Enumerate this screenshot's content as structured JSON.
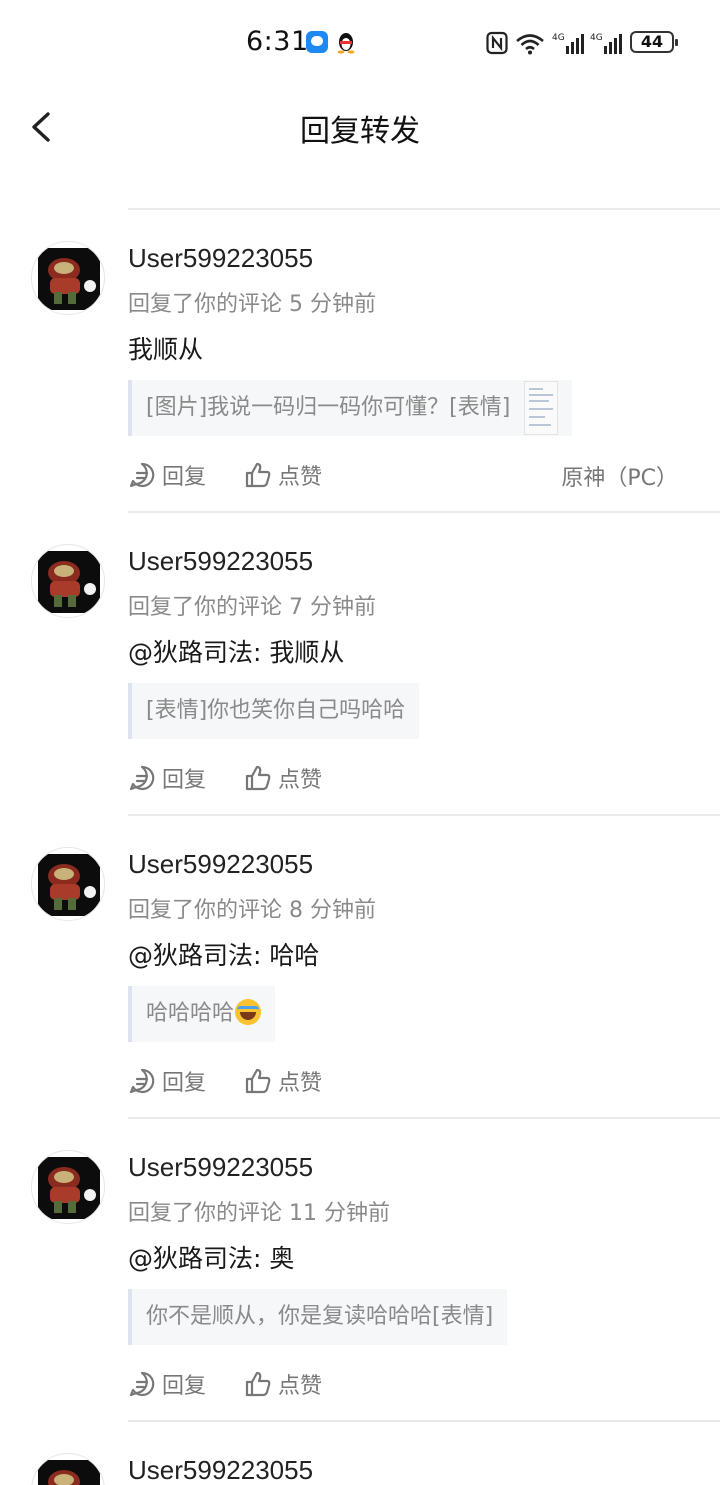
{
  "status_bar": {
    "time": "6:31",
    "battery": "44"
  },
  "header": {
    "title": "回复转发"
  },
  "items": [
    {
      "username": "User599223055",
      "meta": "回复了你的评论 5 分钟前",
      "content": "我顺从",
      "quote": "[图片]我说一码归一码你可懂？[表情]",
      "has_thumb": true,
      "reply_label": "回复",
      "like_label": "点赞",
      "platform": "原神（PC）"
    },
    {
      "username": "User599223055",
      "meta": "回复了你的评论 7 分钟前",
      "content": "@狄路司法: 我顺从",
      "quote": "[表情]你也笑你自己吗哈哈",
      "reply_label": "回复",
      "like_label": "点赞"
    },
    {
      "username": "User599223055",
      "meta": "回复了你的评论 8 分钟前",
      "content": "@狄路司法: 哈哈",
      "quote": "哈哈哈哈",
      "quote_emoji": "laughing-crying-emoji",
      "reply_label": "回复",
      "like_label": "点赞"
    },
    {
      "username": "User599223055",
      "meta": "回复了你的评论 11 分钟前",
      "content": "@狄路司法: 奥",
      "quote": "你不是顺从，你是复读哈哈哈[表情]",
      "reply_label": "回复",
      "like_label": "点赞"
    },
    {
      "username": "User599223055"
    }
  ],
  "icons": {
    "back": "chevron-left-icon",
    "reply": "comment-bubble-icon",
    "like": "thumbs-up-icon"
  },
  "colors": {
    "divider": "#e9e9e9",
    "quote_bg": "#f6f7f9",
    "quote_bar": "#dde3ec",
    "meta": "#8a8a8a"
  }
}
